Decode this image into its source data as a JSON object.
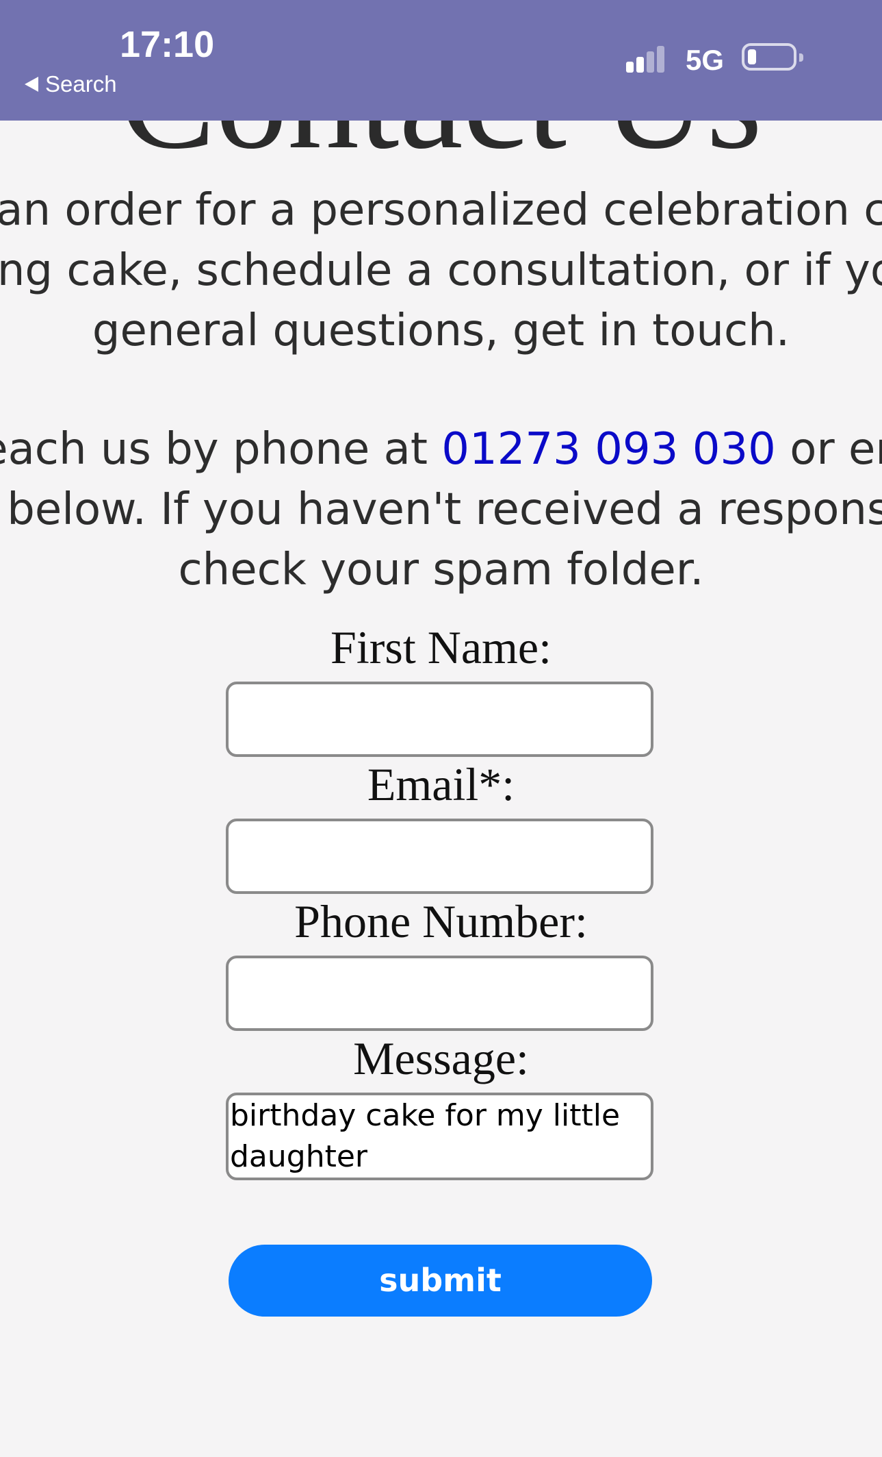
{
  "status_bar": {
    "time": "17:10",
    "back_label": "Search",
    "network": "5G",
    "signal_bars_filled": 2,
    "signal_bars_total": 4,
    "battery_level_fraction": 0.1,
    "background_color": "#7272b0"
  },
  "page": {
    "heading": "Contact Us",
    "intro_lines": [
      "e an order for a personalized celebration cal",
      "ding cake, schedule a consultation, or if you",
      "general questions, get in touch."
    ],
    "reach_line_1_before": "reach us by phone at ",
    "phone_number": "01273 093 030",
    "reach_line_1_after": " or em",
    "reach_lines_rest": [
      "n below. If you haven't received a response",
      "check your spam folder."
    ],
    "link_color": "#0a0ac8"
  },
  "form": {
    "first_name_label": "First Name:",
    "first_name_value": "",
    "email_label": "Email*:",
    "email_value": "",
    "phone_label": "Phone Number:",
    "phone_value": "",
    "message_label": "Message:",
    "message_value_line_1": "birthday cake for my little",
    "message_value_line_2": "daughter",
    "submit_label": "submit",
    "submit_color": "#0b7dff"
  }
}
